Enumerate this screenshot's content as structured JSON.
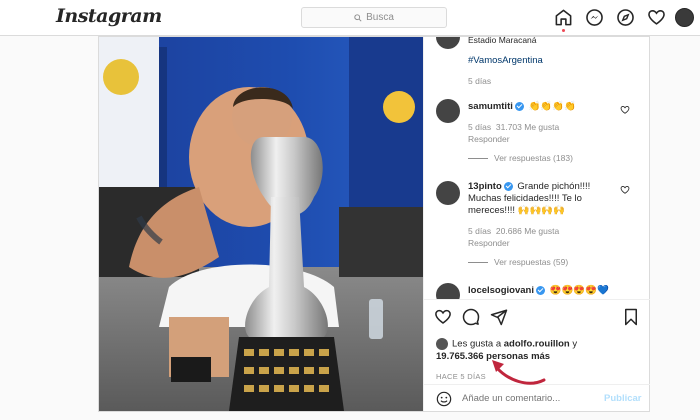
{
  "header": {
    "logo": "Instagram",
    "search_placeholder": "Busca",
    "icons": [
      "home-icon",
      "direct-icon",
      "explore-icon",
      "activity-icon",
      "profile-avatar"
    ]
  },
  "post": {
    "location": "Estadio Maracaná",
    "hashtag": "#VamosArgentina",
    "caption_age": "5 días",
    "comments": [
      {
        "user": "samumtiti",
        "verified": true,
        "text": "👏👏👏👏",
        "age": "5 días",
        "likes": "31.703 Me gusta",
        "reply": "Responder",
        "view_replies": "Ver respuestas (183)"
      },
      {
        "user": "13pinto",
        "verified": true,
        "text": "Grande pichón!!!! Muchas felicidades!!!! Te lo mereces!!!! 🙌🙌🙌🙌",
        "age": "5 días",
        "likes": "20.686 Me gusta",
        "reply": "Responder",
        "view_replies": "Ver respuestas (59)"
      },
      {
        "user": "locelsogiovani",
        "verified": true,
        "text": "😍😍😍😍💙"
      }
    ],
    "likes_prefix": "Les gusta a",
    "likes_user": "adolfo.rouillon",
    "likes_mid": "y",
    "likes_count": "19.765.366 personas más",
    "time_ago": "HACE 5 DÍAS",
    "comment_placeholder": "Añade un comentario...",
    "publish": "Publicar"
  },
  "colors": {
    "accent": "#0095f6",
    "annotation_arrow": "#c0263d"
  }
}
